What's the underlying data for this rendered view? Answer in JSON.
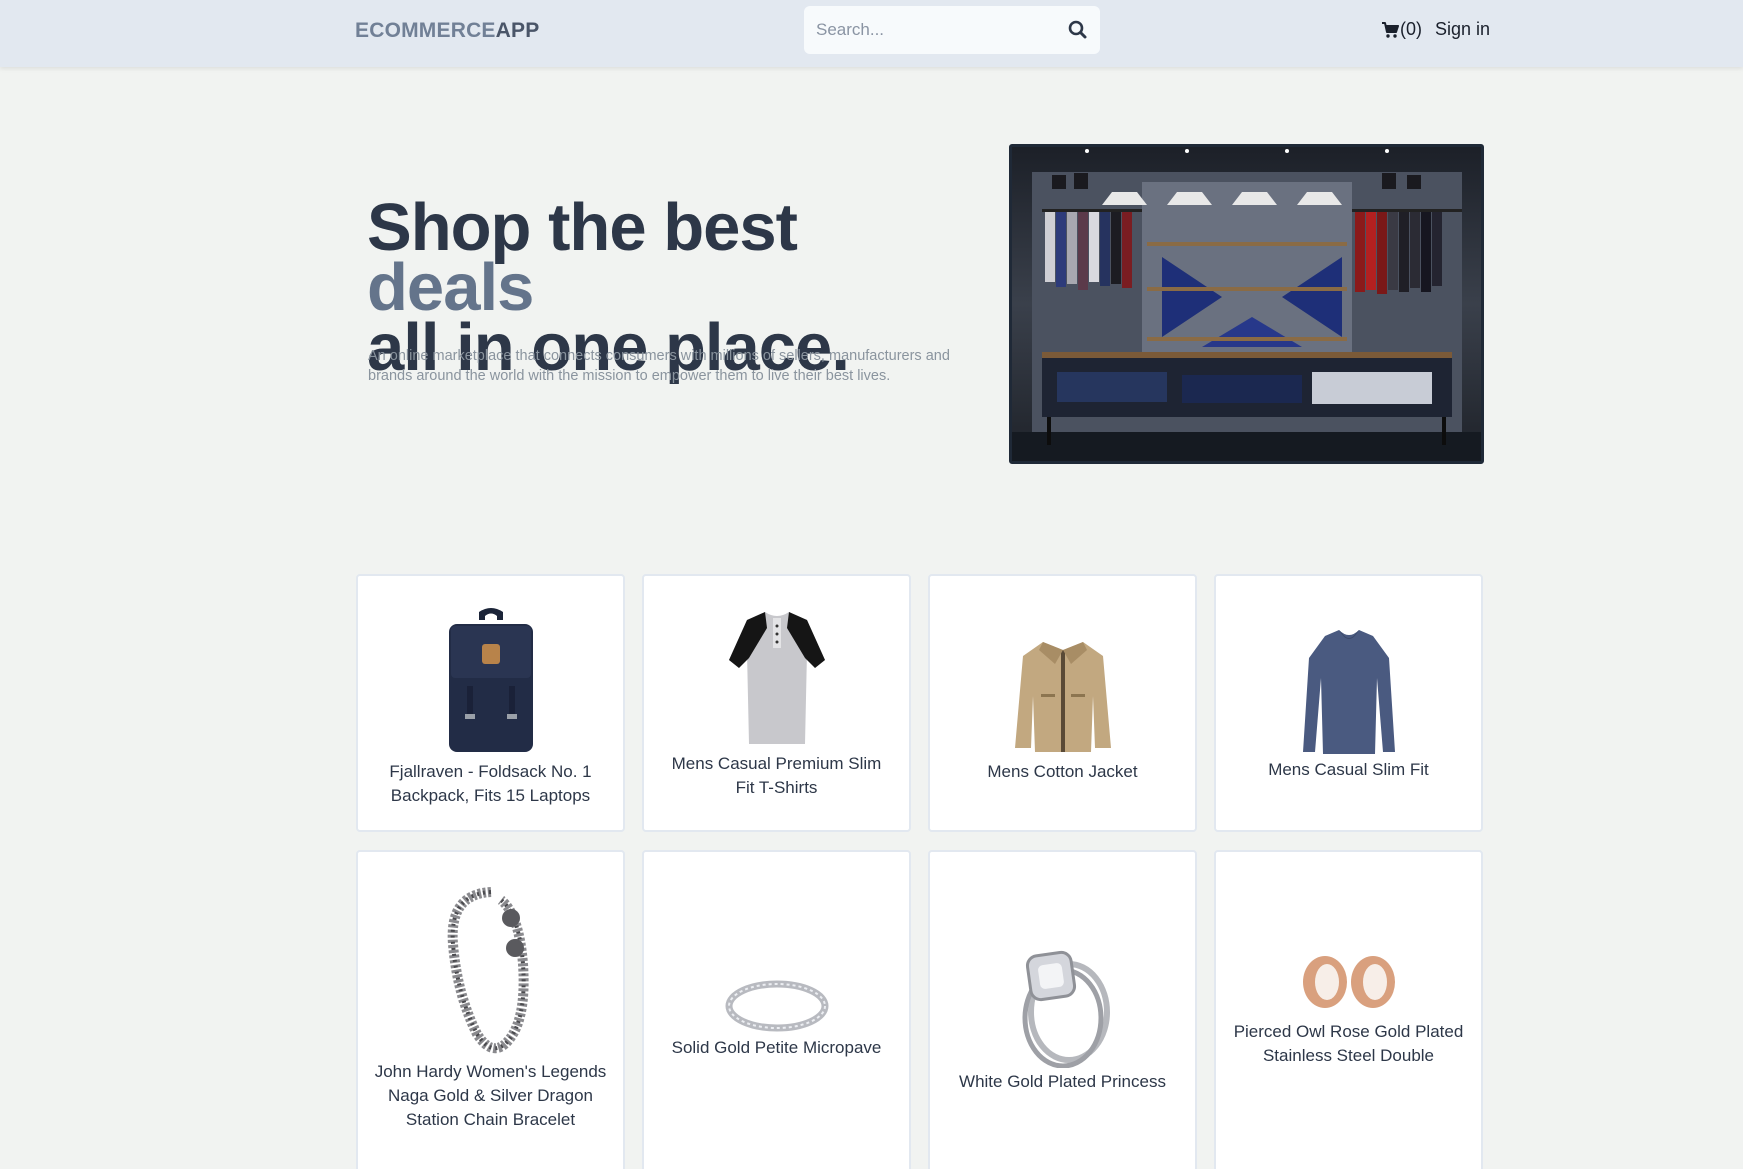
{
  "header": {
    "logo_prefix": "ECOMMERCE",
    "logo_suffix": "APP",
    "search_placeholder": "Search...",
    "cart_label": "(0)",
    "signin_label": "Sign in"
  },
  "hero": {
    "title_part1": "Shop the best ",
    "title_accent": "deals",
    "title_part2": "all in one place.",
    "description": "An online marketplace that connects consumers with millions of sellers, manufacturers and brands around the world with the mission to empower them to live their best lives."
  },
  "products": [
    {
      "name": "Fjallraven - Foldsack No. 1 Backpack, Fits 15 Laptops",
      "icon": "backpack"
    },
    {
      "name": "Mens Casual Premium Slim Fit T-Shirts",
      "icon": "t-shirt"
    },
    {
      "name": "Mens Cotton Jacket",
      "icon": "jacket"
    },
    {
      "name": "Mens Casual Slim Fit",
      "icon": "long-sleeve-shirt"
    },
    {
      "name": "John Hardy Women's Legends Naga Gold & Silver Dragon Station Chain Bracelet",
      "icon": "bracelet"
    },
    {
      "name": "Solid Gold Petite Micropave",
      "icon": "ring"
    },
    {
      "name": "White Gold Plated Princess",
      "icon": "diamond-ring"
    },
    {
      "name": "Pierced Owl Rose Gold Plated Stainless Steel Double",
      "icon": "ear-plugs"
    }
  ],
  "colors": {
    "header_bg": "#e2e8f0",
    "page_bg": "#f1f3f1",
    "heading": "#2d3748",
    "accent": "#64748b"
  }
}
